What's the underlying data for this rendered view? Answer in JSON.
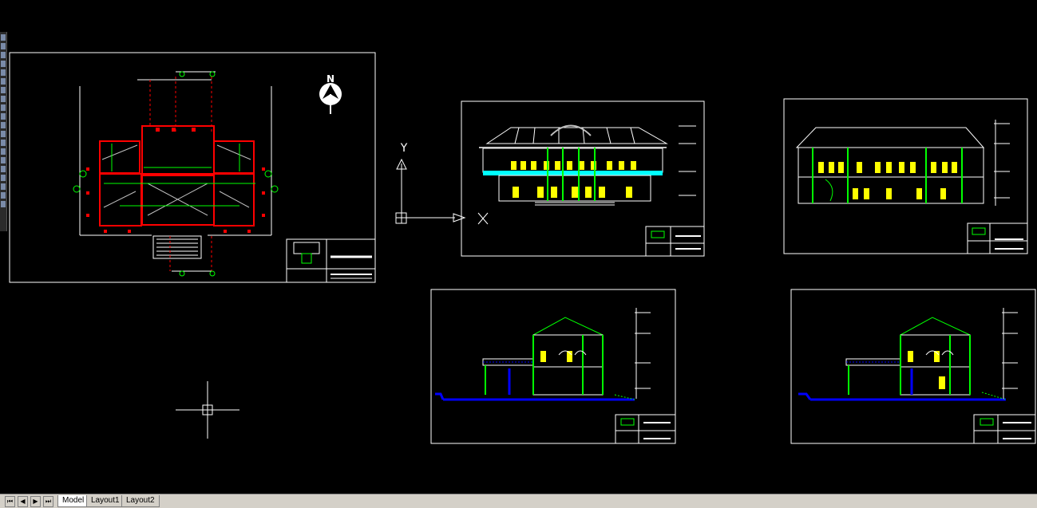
{
  "app": {
    "type": "cad-drawing-viewer"
  },
  "north_arrow": {
    "label": "N"
  },
  "ucs_icon": {
    "y_label": "Y",
    "x_label": "X"
  },
  "status_bar": {
    "nav_buttons": [
      "first-tab",
      "previous-tab",
      "next-tab",
      "last-tab"
    ],
    "tabs": [
      {
        "label": "Model",
        "active": true
      },
      {
        "label": "Layout1",
        "active": false
      },
      {
        "label": "Layout2",
        "active": false
      }
    ]
  },
  "colors": {
    "background": "#000000",
    "sheet_border": "#ffffff",
    "wall_red": "#ff0000",
    "dimension_green": "#00ff00",
    "window_yellow": "#ffff00",
    "railing_cyan": "#00ffff",
    "ground_blue": "#0000ff",
    "hatch_gray": "#bfbfbf"
  }
}
